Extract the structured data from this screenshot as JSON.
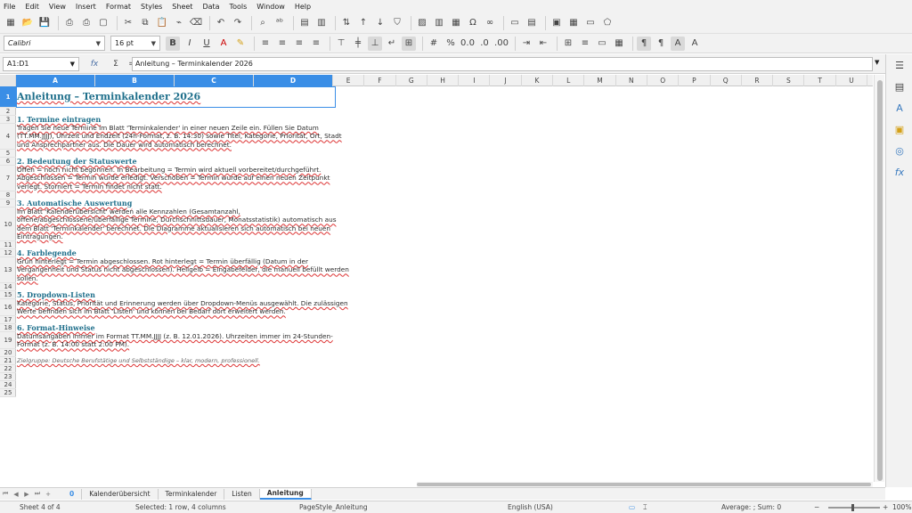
{
  "menu": [
    "File",
    "Edit",
    "View",
    "Insert",
    "Format",
    "Styles",
    "Sheet",
    "Data",
    "Tools",
    "Window",
    "Help"
  ],
  "toolbar": {
    "font_name": "Calibri",
    "font_size": "16 pt",
    "icons1": [
      "new-icon",
      "open-icon",
      "save-icon",
      "export-pdf-icon",
      "print-icon",
      "print-preview-icon",
      "cut-icon",
      "copy-icon",
      "paste-icon",
      "clone-format-icon",
      "clear-format-icon",
      "undo-icon",
      "redo-icon",
      "find-replace-icon",
      "spellcheck-icon",
      "row-icon",
      "column-icon",
      "sort-icon",
      "sort-ascending-icon",
      "sort-descending-icon",
      "autofilter-icon",
      "image-icon",
      "chart-icon",
      "pivot-table-icon",
      "special-character-icon",
      "hyperlink-icon",
      "comment-icon",
      "headers-footers-icon",
      "define-print-area-icon",
      "freeze-rows-icon",
      "split-window-icon",
      "shapes-icon"
    ],
    "icons2": [
      "bold-icon",
      "italic-icon",
      "underline-icon",
      "font-color-icon",
      "highlight-icon",
      "align-left-icon",
      "align-center-icon",
      "align-right-icon",
      "justify-icon",
      "align-top-icon",
      "align-vcenter-icon",
      "align-bottom-icon",
      "wrap-text-icon",
      "merge-center-icon",
      "number-format-icon",
      "percent-icon",
      "decimal-icon",
      "add-decimal-icon",
      "delete-decimal-icon",
      "increase-indent-icon",
      "decrease-indent-icon",
      "borders-icon",
      "border-style-icon",
      "border-color-icon",
      "conditional-format-icon",
      "text-direction-ltr-icon",
      "text-direction-rtl-icon",
      "text-vertical-icon",
      "text-vertical-rtl-icon"
    ]
  },
  "formula": {
    "name_box": "A1:D1",
    "content": "Anleitung – Terminkalender 2026"
  },
  "columns": [
    "A",
    "B",
    "C",
    "D",
    "E",
    "F",
    "G",
    "H",
    "I",
    "J",
    "K",
    "L",
    "M",
    "N",
    "O",
    "P",
    "Q",
    "R",
    "S",
    "T",
    "U"
  ],
  "rows": [
    "1",
    "2",
    "3",
    "4",
    "5",
    "6",
    "7",
    "8",
    "9",
    "10",
    "11",
    "12",
    "13",
    "14",
    "15",
    "16",
    "17",
    "18",
    "19",
    "20",
    "21",
    "22",
    "23",
    "24",
    "25"
  ],
  "cells": {
    "r1": "Anleitung – Terminkalender 2026",
    "r3": "1. Termine eintragen",
    "r4_l1": "Tragen Sie neue Termine im Blatt 'Terminkalender' in einer neuen Zeile ein. Füllen Sie Datum",
    "r4_l2": "(TT.MM.JJJJ), Uhrzeit und Endzeit (24h-Format, z. B. 14:30) sowie Titel, Kategorie, Priorität, Ort, Stadt",
    "r4_l3": "und Ansprechpartner aus. Die Dauer wird automatisch berechnet.",
    "r6": "2. Bedeutung der Statuswerte",
    "r7_l1": "Offen = noch nicht begonnen. In Bearbeitung = Termin wird aktuell vorbereitet/durchgeführt.",
    "r7_l2": "Abgeschlossen = Termin wurde erledigt. Verschoben = Termin wurde auf einen neuen Zeitpunkt",
    "r7_l3": "verlegt. Storniert = Termin findet nicht statt.",
    "r9": "3. Automatische Auswertung",
    "r10_l1": "Im Blatt 'Kalenderübersicht' werden alle Kennzahlen (Gesamtanzahl,",
    "r10_l2": "offene/abgeschlossene/überfällige Termine, Durchschnittsdauer, Monatsstatistik) automatisch aus",
    "r10_l3": "dem Blatt 'Terminkalender' berechnet. Die Diagramme aktualisieren sich automatisch bei neuen",
    "r10_l4": "Eintragungen.",
    "r12": "4. Farblegende",
    "r13_l1": "Grün hinterlegt = Termin abgeschlossen. Rot hinterlegt = Termin überfällig (Datum in der",
    "r13_l2": "Vergangenheit und Status nicht abgeschlossen). Hellgelb = Eingabefelder, die manuell befüllt werden",
    "r13_l3": "sollen.",
    "r15": "5. Dropdown-Listen",
    "r16_l1": "Kategorie, Status, Priorität und Erinnerung werden über Dropdown-Menüs ausgewählt. Die zulässigen",
    "r16_l2": "Werte befinden sich im Blatt 'Listen' und können bei Bedarf dort erweitert werden.",
    "r18": "6. Format-Hinweise",
    "r19_l1": "Datumsangaben immer im Format TT.MM.JJJJ (z. B. 12.01.2026). Uhrzeiten immer im 24-Stunden-",
    "r19_l2": "Format (z. B. 14:00 statt 2:00 PM).",
    "r21": "Zielgruppe: Deutsche Berufstätige und Selbstständige – klar, modern, professionell."
  },
  "tabs": [
    "Kalenderübersicht",
    "Terminkalender",
    "Listen",
    "Anleitung"
  ],
  "tab_count_badge": "0",
  "status": {
    "sheet": "Sheet 4 of 4",
    "selection": "Selected: 1 row, 4 columns",
    "page_style": "PageStyle_Anleitung",
    "language": "English (USA)",
    "summary": "Average: ; Sum: 0",
    "zoom": "100%"
  }
}
